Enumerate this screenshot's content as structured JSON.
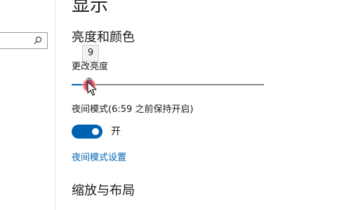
{
  "page": {
    "title": "显示"
  },
  "search": {
    "placeholder": ""
  },
  "brightness": {
    "section_title": "亮度和颜色",
    "slider_label": "更改亮度",
    "value": 9,
    "value_display": "9",
    "min": 0,
    "max": 100
  },
  "night_light": {
    "status": "夜间模式(6:59 之前保持开启)",
    "toggle_on": true,
    "toggle_label": "开",
    "settings_link": "夜间模式设置"
  },
  "scale_layout": {
    "section_title": "缩放与布局"
  },
  "colors": {
    "accent": "#0063b1",
    "click_marker": "#e64646"
  },
  "icons": {
    "search": "search-icon",
    "cursor": "mouse-pointer-icon"
  }
}
